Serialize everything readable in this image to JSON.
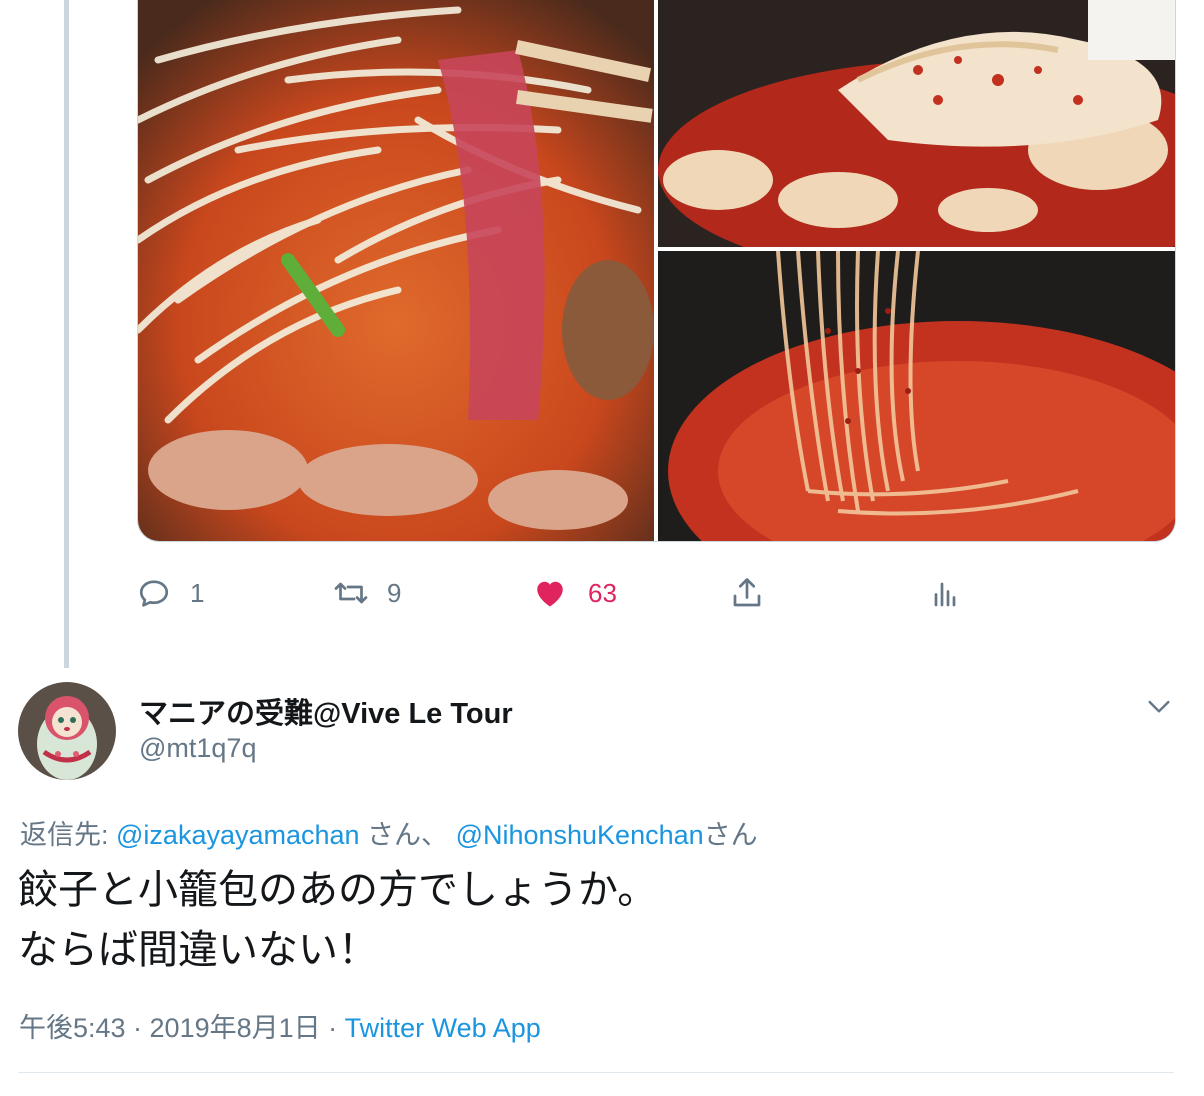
{
  "parent_tweet": {
    "media": [
      {
        "name": "hotpot-bean-sprouts-pork"
      },
      {
        "name": "spicy-dumplings-spoon"
      },
      {
        "name": "spicy-noodles-chopsticks"
      }
    ],
    "actions": {
      "reply_count": "1",
      "retweet_count": "9",
      "like_count": "63",
      "like_color": "#e0245e"
    }
  },
  "reply_tweet": {
    "display_name": "マニアの受難@Vive Le Tour",
    "handle": "@mt1q7q",
    "reply_prefix": "返信先: ",
    "reply_user_1": "@izakayayamachan",
    "reply_sep": " さん、 ",
    "reply_user_2": "@NihonshuKenchan",
    "reply_suffix": "さん",
    "text_line_1": "餃子と小籠包のあの方でしょうか。",
    "text_line_2": "ならば間違いない！",
    "timestamp": "午後5:43 · 2019年8月1日",
    "meta_sep": " · ",
    "source": "Twitter Web App",
    "link_color": "#1b95e0"
  }
}
